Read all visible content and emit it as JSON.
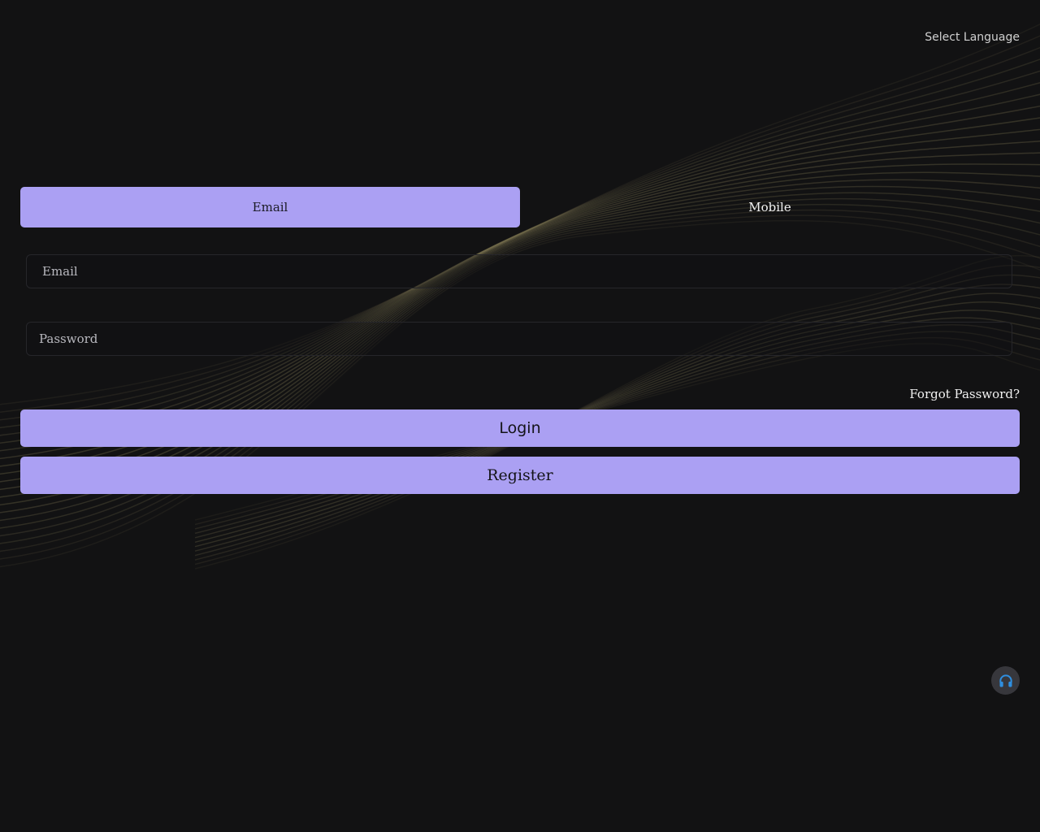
{
  "header": {
    "language_label": "Select Language"
  },
  "tabs": [
    {
      "label": "Email",
      "active": true
    },
    {
      "label": "Mobile",
      "active": false
    }
  ],
  "form": {
    "email_placeholder": "Email",
    "password_placeholder": "Password",
    "forgot_label": "Forgot Password?",
    "login_label": "Login",
    "register_label": "Register"
  },
  "support": {
    "icon": "headset-icon"
  },
  "colors": {
    "background": "#121213",
    "accent": "#aba0f3",
    "wave": "#7d7552",
    "support_icon": "#2f8fe0"
  }
}
